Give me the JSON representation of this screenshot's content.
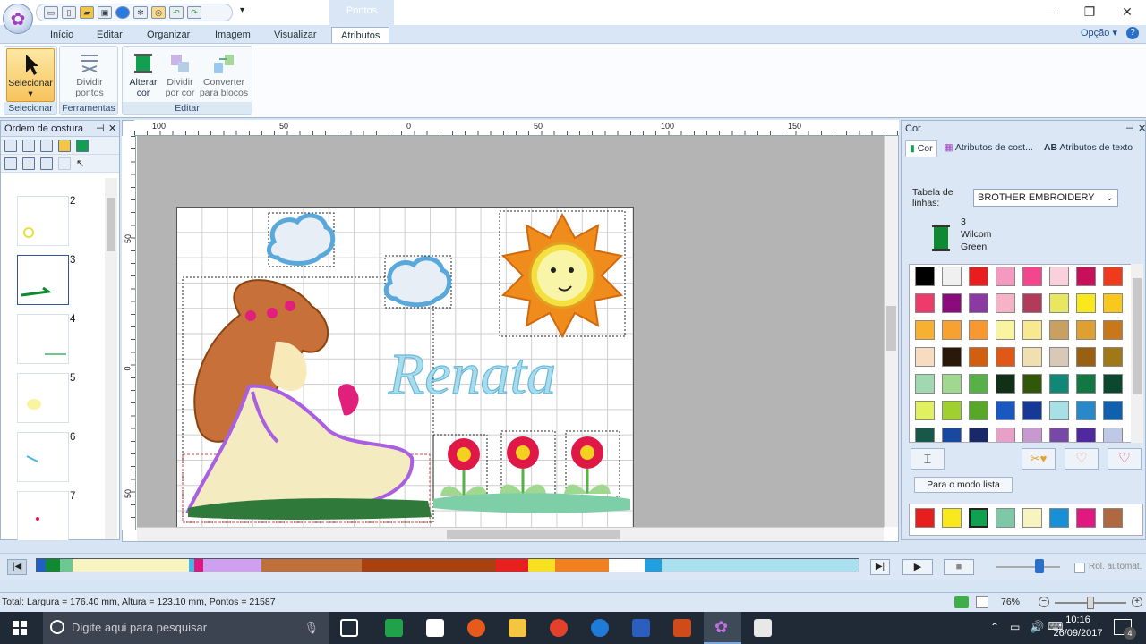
{
  "titlebar": {
    "context_tab": "Pontos",
    "minimize": "—",
    "restore": "❐",
    "close": "✕"
  },
  "ribbon_tabs": {
    "inicio": "Início",
    "editar": "Editar",
    "organizar": "Organizar",
    "imagem": "Imagem",
    "visualizar": "Visualizar",
    "atributos": "Atributos",
    "opcao": "Opção"
  },
  "ribbon": {
    "selecionar": "Selecionar",
    "dividir_pontos_1": "Dividir",
    "dividir_pontos_2": "pontos",
    "alterar_cor_1": "Alterar",
    "alterar_cor_2": "cor",
    "dividir_por_cor_1": "Dividir",
    "dividir_por_cor_2": "por cor",
    "converter_1": "Converter",
    "converter_2": "para blocos",
    "group_selecionar": "Selecionar",
    "group_ferramentas": "Ferramentas",
    "group_editar": "Editar"
  },
  "left_panel": {
    "title": "Ordem de costura",
    "items": [
      "2",
      "3",
      "4",
      "5",
      "6",
      "7"
    ]
  },
  "rulers": {
    "h": [
      "100",
      "50",
      "0",
      "50",
      "100",
      "150"
    ],
    "v": [
      "50",
      "0",
      "50"
    ]
  },
  "design": {
    "name_text": "Renata"
  },
  "right_panel": {
    "title": "Cor",
    "tab_cor": "Cor",
    "tab_atributos_costura": "Atributos de cost...",
    "tab_atributos_texto": "Atributos de texto",
    "tabela_label": "Tabela de linhas:",
    "tabela_value": "BROTHER EMBROIDERY",
    "thread_number": "3",
    "thread_brand": "Wilcom",
    "thread_name": "Green",
    "list_mode_button": "Para o modo lista",
    "swatches": [
      "#000000",
      "#f0f0f0",
      "#e81e1e",
      "#f49ac1",
      "#f4468c",
      "#f9d0dc",
      "#c8105a",
      "#ef3b1c",
      "#ef3b6c",
      "#8b0a7c",
      "#8a3aa0",
      "#f6b3c8",
      "#b23a5a",
      "#e8e860",
      "#f8e81c",
      "#f8c81c",
      "#f8b030",
      "#f8a030",
      "#f89830",
      "#f8f4a0",
      "#f8e890",
      "#c8a060",
      "#e0a030",
      "#c87818",
      "#f8dcc0",
      "#2a1808",
      "#d06010",
      "#e05818",
      "#f0e0b0",
      "#d8c8b8",
      "#9a6010",
      "#a07818",
      "#a0d8b0",
      "#a0d890",
      "#58b048",
      "#103018",
      "#305808",
      "#108878",
      "#107840",
      "#0a4830",
      "#e0f060",
      "#a0d030",
      "#58a828",
      "#1858c0",
      "#183898",
      "#a8e0e8",
      "#2888c8",
      "#1060b0",
      "#185848",
      "#1848a0",
      "#182868",
      "#e8a0c8",
      "#c898d0",
      "#7848a8",
      "#5028a0",
      "#c0c8e8"
    ],
    "recent": [
      "#e81e1e",
      "#f8e81c",
      "#10a050",
      "#7ec8a8",
      "#f8f4c0",
      "#1890d8",
      "#e01880",
      "#b06840"
    ]
  },
  "sequence_bar": {
    "colors": [
      "#2060c0",
      "#108a30",
      "#6cc890",
      "#f8f4c0",
      "#40b8e8",
      "#e01880",
      "#d0a0f0",
      "#c0703a",
      "#a84010",
      "#e82020",
      "#f8e020",
      "#f08020",
      "#ffffff",
      "#20a0e0",
      "#a8e0f0"
    ],
    "widths": [
      10,
      16,
      14,
      130,
      6,
      10,
      66,
      112,
      150,
      36,
      30,
      60,
      40,
      20,
      220
    ]
  },
  "statusbar": {
    "total": "Total: Largura = 176.40 mm, Altura = 123.10 mm, Pontos = 21587",
    "zoom": "76%",
    "rol_automat": "Rol. automat."
  },
  "taskbar": {
    "search_placeholder": "Digite aqui para pesquisar",
    "time": "10:16",
    "date": "26/09/2017",
    "notifications": "4"
  }
}
